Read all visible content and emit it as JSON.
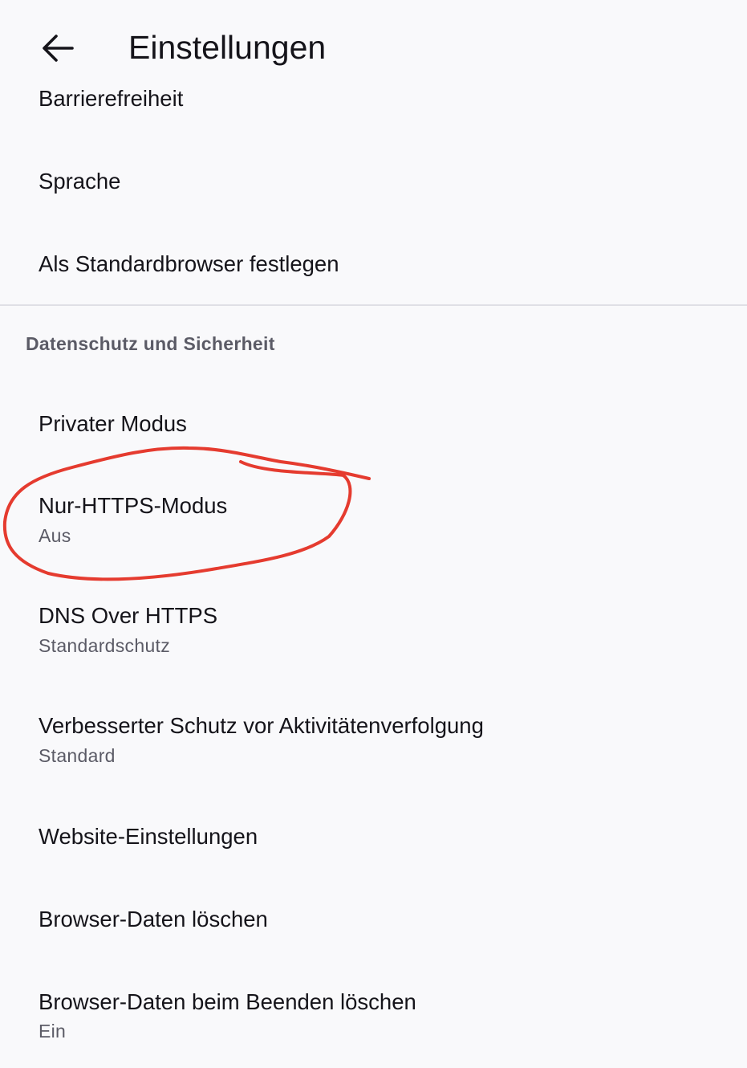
{
  "toolbar": {
    "back_icon": "arrow-left-icon",
    "title": "Einstellungen"
  },
  "general_items": [
    {
      "title": "Barrierefreiheit"
    },
    {
      "title": "Sprache"
    },
    {
      "title": "Als Standardbrowser festlegen"
    }
  ],
  "privacy_section": {
    "header": "Datenschutz und Sicherheit",
    "items": [
      {
        "title": "Privater Modus"
      },
      {
        "title": "Nur-HTTPS-Modus",
        "subtitle": "Aus"
      },
      {
        "title": "DNS Over HTTPS",
        "subtitle": "Standardschutz"
      },
      {
        "title": "Verbesserter Schutz vor Aktivitätenverfolgung",
        "subtitle": "Standard"
      },
      {
        "title": "Website-Einstellungen"
      },
      {
        "title": "Browser-Daten löschen"
      },
      {
        "title": "Browser-Daten beim Beenden löschen",
        "subtitle": "Ein"
      }
    ]
  },
  "colors": {
    "background": "#f9f9fb",
    "text_primary": "#15141a",
    "text_secondary": "#5b5b66",
    "annotation": "#e53b2f"
  }
}
